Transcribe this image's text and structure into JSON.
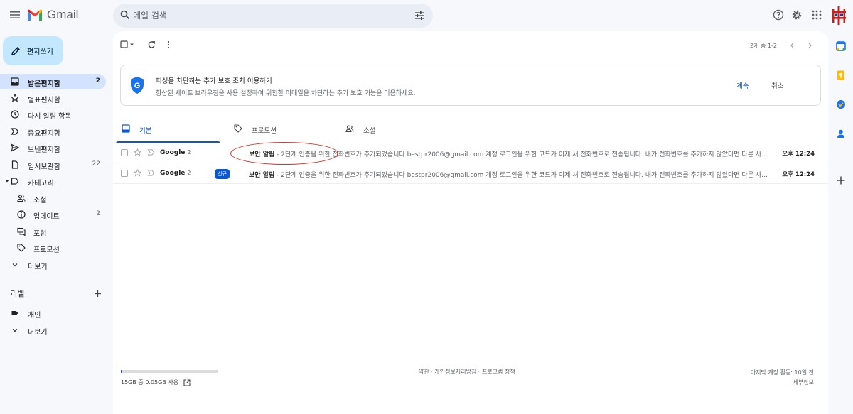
{
  "app": {
    "name": "Gmail"
  },
  "search": {
    "placeholder": "메일 검색"
  },
  "compose": {
    "label": "편지쓰기"
  },
  "sidebar": {
    "items": [
      {
        "label": "받은편지함",
        "count": "2"
      },
      {
        "label": "별표편지함",
        "count": ""
      },
      {
        "label": "다시 알림 항목",
        "count": ""
      },
      {
        "label": "중요편지함",
        "count": ""
      },
      {
        "label": "보낸편지함",
        "count": ""
      },
      {
        "label": "임시보관함",
        "count": "22"
      },
      {
        "label": "카테고리",
        "count": ""
      }
    ],
    "categories": [
      {
        "label": "소셜",
        "count": ""
      },
      {
        "label": "업데이트",
        "count": "2"
      },
      {
        "label": "포럼",
        "count": ""
      },
      {
        "label": "프로모션",
        "count": ""
      }
    ],
    "more_label": "더보기",
    "labels_title": "라벨",
    "label_items": [
      {
        "label": "개인"
      }
    ],
    "labels_more": "더보기"
  },
  "toolbar": {
    "pager_text": "2개 중 1-2"
  },
  "promo": {
    "title": "피싱을 차단하는 추가 보호 조치 이용하기",
    "description": "향상된 세이프 브라우징을 사용 설정하여 위험한 이메일을 차단하는 추가 보호 기능을 이용하세요.",
    "continue_label": "계속",
    "cancel_label": "취소"
  },
  "tabs": [
    {
      "label": "기본"
    },
    {
      "label": "프로모션"
    },
    {
      "label": "소셜"
    }
  ],
  "emails": [
    {
      "sender": "Google",
      "thread_count": "2",
      "badge": "",
      "subject": "보안 알림",
      "snippet": " - 2단계 인증을 위한 전화번호가 추가되었습니다 bestpr2006@gmail.com 계정 로그인을 위한 코드가 이제 새 전화번호로 전송됩니다. 내가 전화번호를 추가하지 않았다면 다른 사용자가",
      "time": "오후 12:24"
    },
    {
      "sender": "Google",
      "thread_count": "2",
      "badge": "신규",
      "subject": "보안 알림",
      "snippet": " - 2단계 인증을 위한 전화번호가 추가되었습니다 bestpr2006@gmail.com 계정 로그인을 위한 코드가 이제 새 전화번호로 전송됩니다. 내가 전화번호를 추가하지 않았다면 다른 사용자가",
      "time": "오후 12:24"
    }
  ],
  "footer": {
    "storage_text": "15GB 중 0.05GB 사용",
    "storage_used_fraction": 0.003,
    "links": "약관 · 개인정보처리방침 · 프로그램 정책",
    "last_activity": "마지막 계정 활동: 10일 전",
    "details": "세부정보"
  },
  "colors": {
    "accent": "#0b57d0",
    "active_nav": "#d3e3fd",
    "compose_bg": "#c2e7ff",
    "annotation": "#d93025"
  }
}
